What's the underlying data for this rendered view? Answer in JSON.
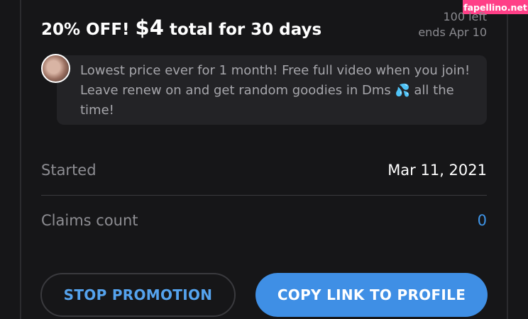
{
  "watermark": "fapellino.net",
  "promo": {
    "title_prefix": "20% OFF! ",
    "price": "$4",
    "title_suffix": " total for 30 days",
    "remaining": "100 left",
    "ends": "ends Apr 10"
  },
  "message": {
    "text": "Lowest price ever for 1 month! Free full video when you join! Leave renew on and get random goodies in Dms",
    "emoji": "💦",
    "text_end": " all the time!"
  },
  "details": {
    "started_label": "Started",
    "started_value": "Mar 11, 2021",
    "claims_label": "Claims count",
    "claims_value": "0"
  },
  "actions": {
    "stop_label": "STOP PROMOTION",
    "copy_label": "COPY LINK TO PROFILE"
  },
  "colors": {
    "background": "#161618",
    "accent": "#3f8fe5",
    "link": "#55a3ee",
    "watermark": "#ff3f87"
  },
  "icons": {
    "avatar": "user-avatar",
    "emoji": "sweat-droplets-icon"
  }
}
